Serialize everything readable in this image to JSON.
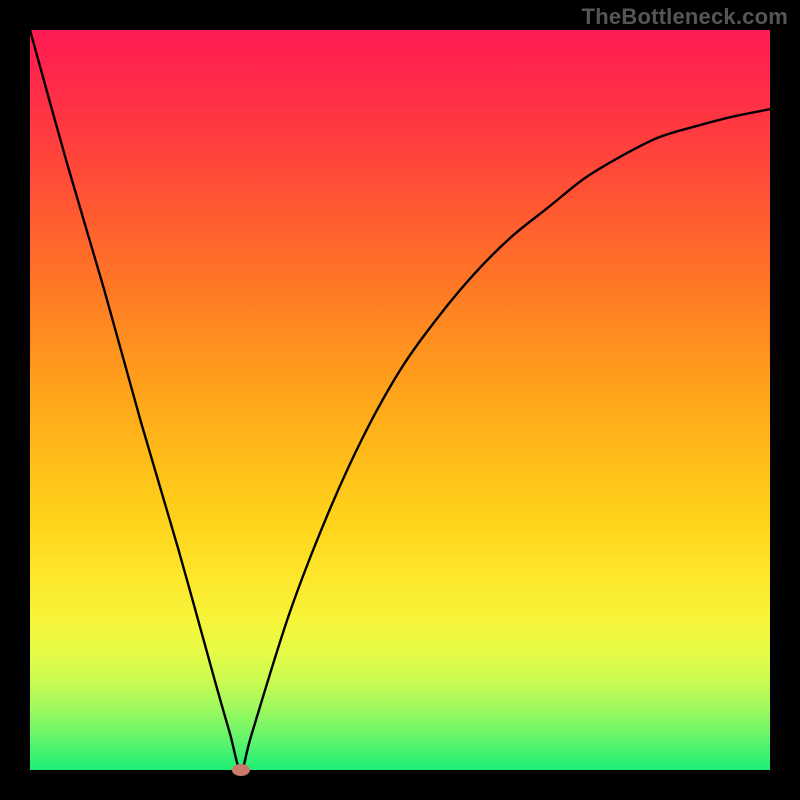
{
  "watermark": "TheBottleneck.com",
  "colors": {
    "background": "#000000",
    "curve": "#000000",
    "marker_fill": "#c97a6a",
    "gradient_top": "#ff1a54",
    "gradient_mid1": "#ff8f1f",
    "gradient_mid2": "#fee72c",
    "gradient_bottom": "#1dee76"
  },
  "chart_data": {
    "type": "line",
    "title": "",
    "xlabel": "",
    "ylabel": "",
    "xlim": [
      0,
      100
    ],
    "ylim": [
      0,
      100
    ],
    "series": [
      {
        "name": "curve",
        "x": [
          0,
          5,
          10,
          15,
          20,
          25,
          27,
          28.5,
          30,
          35,
          40,
          45,
          50,
          55,
          60,
          65,
          70,
          75,
          80,
          85,
          90,
          95,
          100
        ],
        "values": [
          100,
          82,
          65,
          47,
          30,
          12,
          5,
          0,
          5,
          21,
          34,
          45,
          54,
          61,
          67,
          72,
          76,
          80,
          83,
          85.5,
          87,
          88.3,
          89.3
        ]
      }
    ],
    "marker": {
      "x": 28.5,
      "y": 0
    }
  }
}
